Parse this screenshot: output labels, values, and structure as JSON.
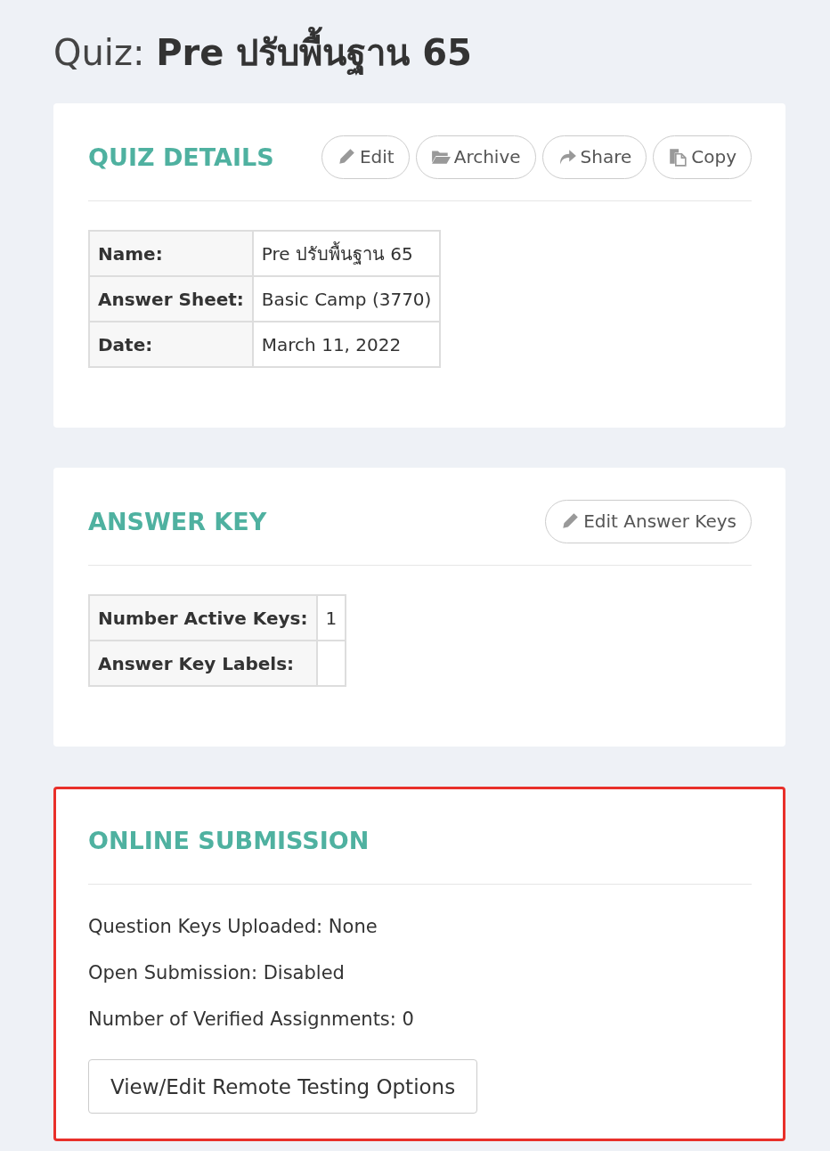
{
  "title": {
    "prefix": "Quiz:",
    "name": "Pre ปรับพื้นฐาน 65"
  },
  "sections": [
    {
      "heading": "QUIZ DETAILS",
      "highlighted": false,
      "actions": [
        {
          "label": "Edit",
          "kind": "pencil"
        },
        {
          "label": "Archive",
          "kind": "folder"
        },
        {
          "label": "Share",
          "kind": "share"
        },
        {
          "label": "Copy",
          "kind": "copy"
        }
      ],
      "table": [
        {
          "label": "Name:",
          "value": "Pre ปรับพื้นฐาน 65"
        },
        {
          "label": "Answer Sheet:",
          "value": "Basic Camp (3770)"
        },
        {
          "label": "Date:",
          "value": "March 11, 2022"
        }
      ]
    },
    {
      "heading": "ANSWER KEY",
      "highlighted": false,
      "actions": [
        {
          "label": "Edit Answer Keys",
          "kind": "pencil"
        }
      ],
      "table": [
        {
          "label": "Number Active Keys:",
          "value": "1"
        },
        {
          "label": "Answer Key Labels:"
        }
      ]
    },
    {
      "heading": "ONLINE SUBMISSION",
      "highlighted": true,
      "lines": [
        "Question Keys Uploaded: None",
        "Open Submission: Disabled",
        "Number of Verified Assignments: 0"
      ],
      "button": "View/Edit Remote Testing Options"
    }
  ]
}
